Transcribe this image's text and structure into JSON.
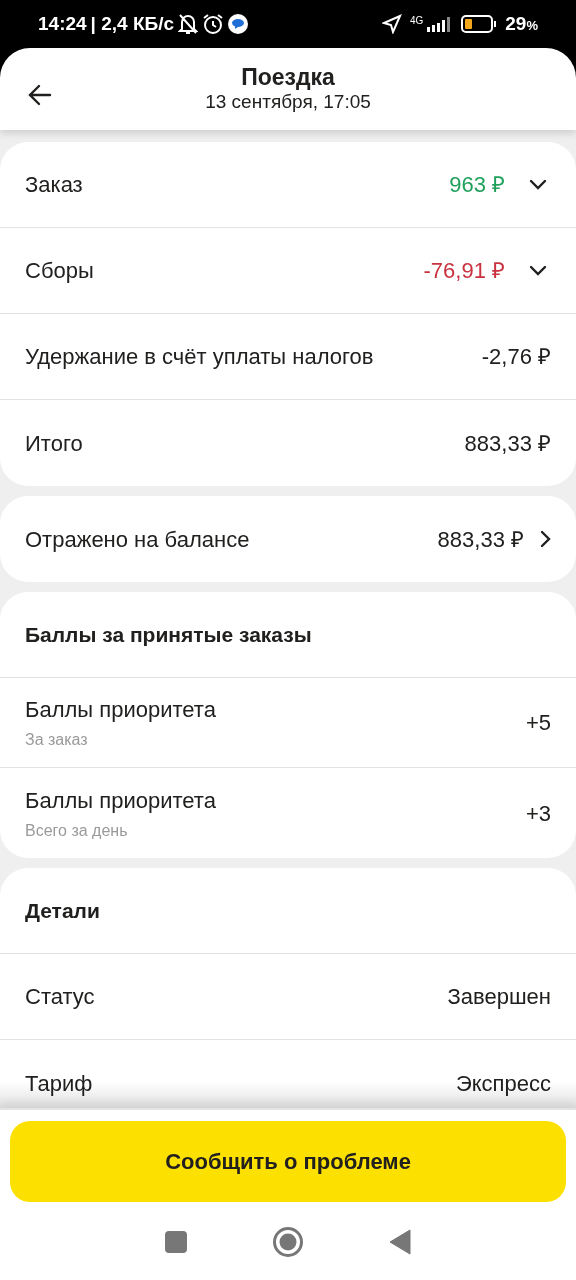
{
  "status_bar": {
    "time": "14:24",
    "speed": "| 2,4 КБ/с",
    "network": "4G",
    "battery": "29",
    "battery_unit": "%"
  },
  "header": {
    "title": "Поездка",
    "subtitle": "13 сентября, 17:05"
  },
  "cards": [
    {
      "rows": [
        {
          "kind": "expandable",
          "label": "Заказ",
          "value": "963 ₽",
          "color": "#21a05c",
          "expanded": false
        },
        {
          "kind": "expandable",
          "label": "Сборы",
          "value": "-76,91 ₽",
          "color": "#c8333f",
          "expanded": false
        },
        {
          "kind": "plain",
          "label": "Удержание в счёт уплаты налогов",
          "value": "-2,76 ₽"
        },
        {
          "kind": "plain",
          "label": "Итого",
          "value": "883,33 ₽"
        }
      ]
    },
    {
      "rows": [
        {
          "kind": "link",
          "label": "Отражено на балансе",
          "value": "883,33 ₽"
        }
      ]
    },
    {
      "title": "Баллы за принятые заказы",
      "rows": [
        {
          "kind": "plain",
          "label": "Баллы приоритета",
          "sublabel": "За заказ",
          "value": "+5"
        },
        {
          "kind": "plain",
          "label": "Баллы приоритета",
          "sublabel": "Всего за день",
          "value": "+3"
        }
      ]
    },
    {
      "title": "Детали",
      "rows": [
        {
          "kind": "plain",
          "label": "Статус",
          "value": "Завершен"
        },
        {
          "kind": "plain",
          "label": "Тариф",
          "value": "Экспресс"
        }
      ]
    }
  ],
  "action_button": "Сообщить о проблеме"
}
